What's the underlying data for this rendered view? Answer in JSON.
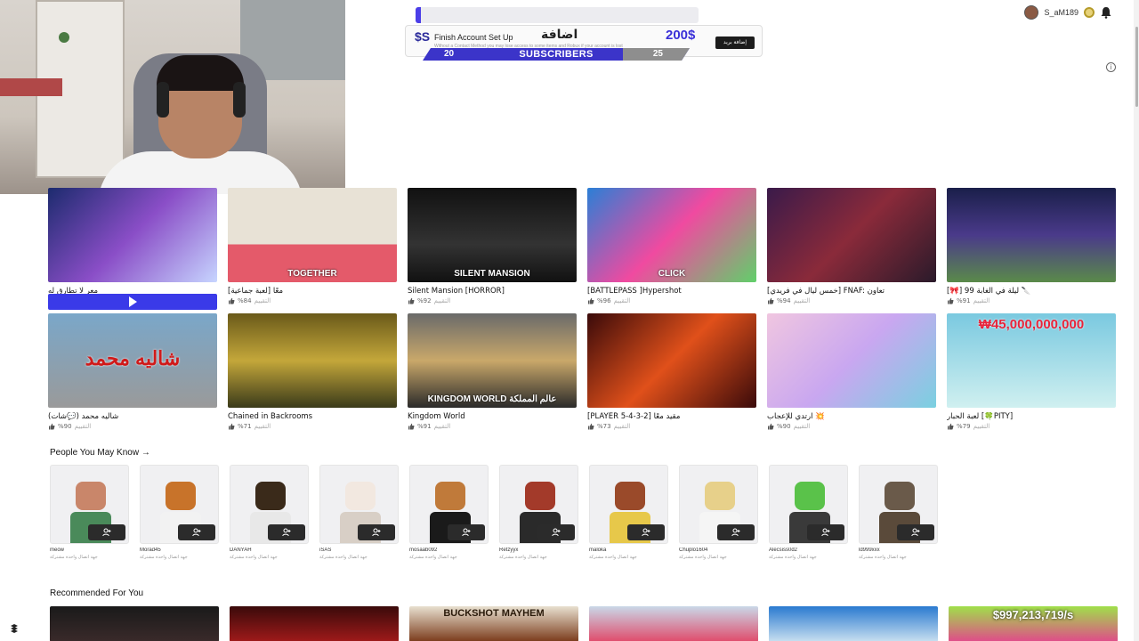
{
  "user": {
    "username": "S_aM189"
  },
  "overlay": {
    "brand": "$S",
    "title": "Finish Account Set Up",
    "subtitle": "Without a Contact Method you may lose access to some items and Robux if your account is lost",
    "arabic_word": "اضافة",
    "money": "200$",
    "add_button": "إضافة بريد",
    "progress_fraction": 0.02,
    "subs_label": "SUBSCRIBERS",
    "subs_start": "20",
    "subs_end": "25",
    "subs_fill_fraction": 0.75
  },
  "colors": {
    "accent": "#3b34c9",
    "dark_button": "#2b2b2b"
  },
  "games_row1": [
    {
      "name": "معر لا تطارق له",
      "rating": "%80",
      "rating_label": "التقييم",
      "caption": "",
      "bg": "linear-gradient(135deg,#1c2b6e,#8a4ec7,#c7d5ff)"
    },
    {
      "name": "[لعبة جماعية] معًا",
      "rating": "%84",
      "rating_label": "التقييم",
      "caption": "TOGETHER",
      "bg": "linear-gradient(180deg,#e8e2d6 60%,#e45a6a 60%)"
    },
    {
      "name": "Silent Mansion [HORROR]",
      "rating": "%92",
      "rating_label": "التقييم",
      "caption": "SILENT MANSION",
      "bg": "linear-gradient(180deg,#111 0%,#333 60%,#111 100%)"
    },
    {
      "name": "[BATTLEPASS ]Hypershot",
      "rating": "%96",
      "rating_label": "التقييم",
      "caption": "CLICK",
      "bg": "linear-gradient(135deg,#2b7fd6,#f04aa0,#60d06a)"
    },
    {
      "name": "[خمس ليال في فريدي] FNAF: تعاون",
      "rating": "%94",
      "rating_label": "التقييم",
      "caption": "",
      "bg": "linear-gradient(135deg,#3a1a4a,#8a2a3a,#2a1a2a)"
    },
    {
      "name": "[🎀] 99 ليلة في الغابة 🔪",
      "rating": "%91",
      "rating_label": "التقييم",
      "caption": "",
      "bg": "linear-gradient(180deg,#1a1f4a,#4a3a8a,#5a8a4a)"
    }
  ],
  "games_row2": [
    {
      "name": "(شات💬) شاليه محمد",
      "rating": "%90",
      "rating_label": "التقييم",
      "caption": "شاليه محمد",
      "bg": "linear-gradient(180deg,#7aa7c9,#9a9a9a)"
    },
    {
      "name": "Chained in Backrooms",
      "rating": "%71",
      "rating_label": "التقييم",
      "caption": "",
      "bg": "linear-gradient(180deg,#6a5a1a,#c4a73a,#3a3a1a)"
    },
    {
      "name": "Kingdom World",
      "rating": "%91",
      "rating_label": "التقييم",
      "caption": "KINGDOM WORLD عالم المملكة",
      "bg": "linear-gradient(180deg,#6a6a6a,#c9a86a,#2a2a2a)"
    },
    {
      "name": "[PLAYER 5-4-3-2] مقيد معًا",
      "rating": "%73",
      "rating_label": "التقييم",
      "caption": "",
      "bg": "linear-gradient(135deg,#3a0a0a,#e0501a,#3a0a0a)"
    },
    {
      "name": "ارتدي للإعجاب 💥",
      "rating": "%90",
      "rating_label": "التقييم",
      "caption": "",
      "bg": "linear-gradient(135deg,#f0c6e0,#c9a7f0,#7ad0e0)"
    },
    {
      "name": "لعبة الحبار [🍀PITY]",
      "rating": "%79",
      "rating_label": "التقييم",
      "caption": "₩45,000,000,000",
      "bg": "linear-gradient(180deg,#7ac9e0,#d0f0f0)"
    }
  ],
  "people_section": {
    "title": "People You May Know →"
  },
  "people": [
    {
      "name": "meow",
      "sub": "جهة اتصال واحدة مشتركة",
      "head": "#c9866a",
      "body": "#4a8a5a"
    },
    {
      "name": "Morad45",
      "sub": "جهة اتصال واحدة مشتركة",
      "head": "#c8732a",
      "body": "#f2f2f2"
    },
    {
      "name": "DANYAH",
      "sub": "جهة اتصال واحدة مشتركة",
      "head": "#3a2a1a",
      "body": "#e8e8e8"
    },
    {
      "name": "iSAS",
      "sub": "جهة اتصال واحدة مشتركة",
      "head": "#f2e8e0",
      "body": "#d8cfc6"
    },
    {
      "name": "mosaab092",
      "sub": "جهة اتصال واحدة مشتركة",
      "head": "#c07a3a",
      "body": "#1a1a1a"
    },
    {
      "name": "Retzyyx",
      "sub": "جهة اتصال واحدة مشتركة",
      "head": "#a33a2a",
      "body": "#2a2a2a"
    },
    {
      "name": "maloka",
      "sub": "جهة اتصال واحدة مشتركة",
      "head": "#9a4a2a",
      "body": "#e7c84a"
    },
    {
      "name": "Chuplo1604",
      "sub": "جهة اتصال واحدة مشتركة",
      "head": "#e7d08a",
      "body": "#f5f5f5"
    },
    {
      "name": "Alecsiss0d2",
      "sub": "جهة اتصال واحدة مشتركة",
      "head": "#5ac24a",
      "body": "#3a3a3a"
    },
    {
      "name": "ld999xxx",
      "sub": "جهة اتصال واحدة مشتركة",
      "head": "#6a5a4a",
      "body": "#5a4a3a"
    }
  ],
  "recommended_section": {
    "title": "Recommended For You"
  },
  "recommended": [
    {
      "caption": "",
      "bg": "linear-gradient(180deg,#1a1a1a,#3a2a2a)"
    },
    {
      "caption": "",
      "bg": "linear-gradient(180deg,#3a0a0a,#a01a1a)"
    },
    {
      "caption": "BUCKSHOT MAYHEM",
      "bg": "linear-gradient(180deg,#e8e0d0,#7a3a1a)"
    },
    {
      "caption": "",
      "bg": "linear-gradient(180deg,#c9d8e8,#e04a6a)"
    },
    {
      "caption": "",
      "bg": "linear-gradient(180deg,#2a7ad0,#c9e0f0)"
    },
    {
      "caption": "$997,213,719/s",
      "bg": "linear-gradient(180deg,#a0e04a,#e04a8a)"
    }
  ]
}
